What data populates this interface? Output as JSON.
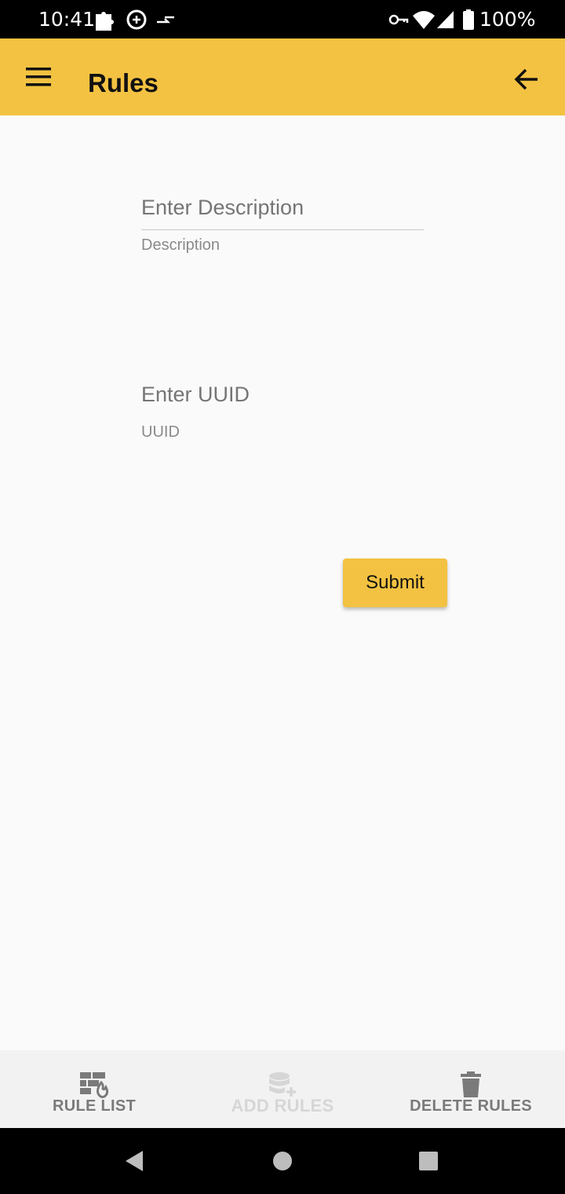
{
  "status_bar": {
    "time": "10:41",
    "battery": "100%"
  },
  "app_bar": {
    "title": "Rules"
  },
  "form": {
    "description": {
      "placeholder": "Enter Description",
      "helper": "Description"
    },
    "uuid": {
      "placeholder": "Enter UUID",
      "helper": "UUID"
    },
    "submit_label": "Submit"
  },
  "bottom_nav": {
    "items": [
      {
        "label": "RULE LIST",
        "icon": "firewall-icon",
        "state": "normal"
      },
      {
        "label": "ADD RULES",
        "icon": "database-add-icon",
        "state": "selected"
      },
      {
        "label": "DELETE RULES",
        "icon": "trash-icon",
        "state": "normal"
      }
    ]
  },
  "colors": {
    "accent": "#f3c242",
    "nav_active_text": "#d6d6d6",
    "nav_text": "#7a7a7a"
  }
}
